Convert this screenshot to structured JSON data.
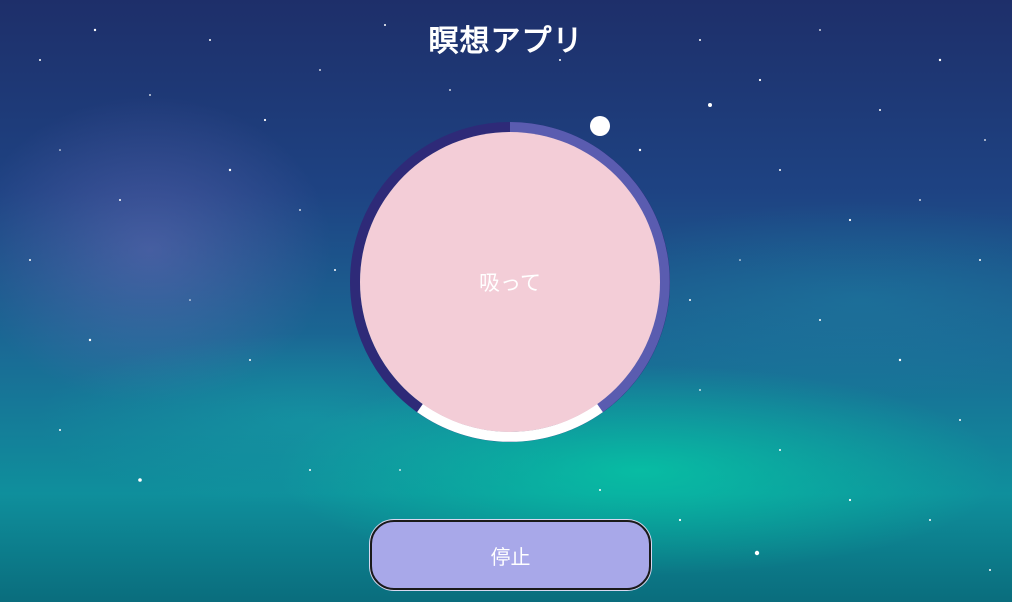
{
  "app": {
    "title": "瞑想アプリ"
  },
  "breathing": {
    "phase_label": "吸って",
    "progress": 0.12
  },
  "controls": {
    "stop_label": "停止"
  },
  "colors": {
    "circle_fill": "#f3cdd7",
    "ring_dark": "#2e2a78",
    "ring_light": "#5a5cb0",
    "ring_highlight": "#ffffff",
    "button_fill": "#a8a8e9"
  }
}
